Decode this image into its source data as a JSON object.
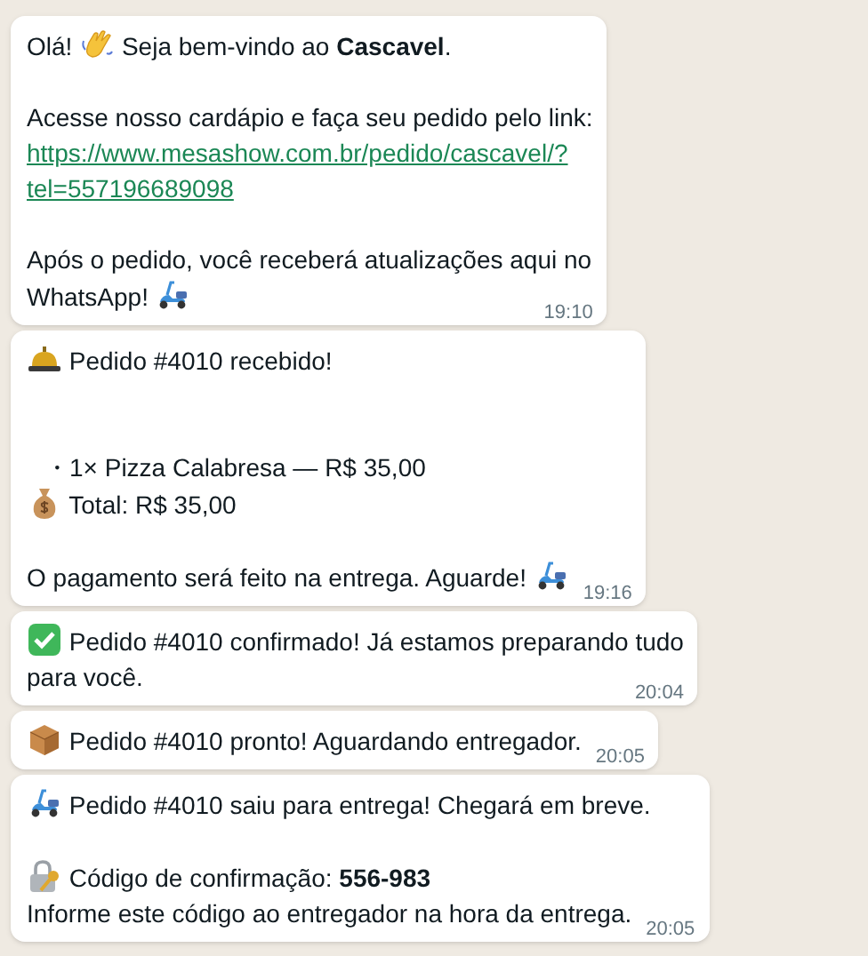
{
  "messages": [
    {
      "time": "19:10",
      "lines": [
        {
          "kind": "text",
          "text": "Olá! ",
          "icon_mid": true,
          "after": "Seja bem-vindo ao **Cascavel**."
        },
        {
          "kind": "blank"
        },
        {
          "kind": "text",
          "text": "Acesse nosso cardápio e faça seu pedido pelo link:"
        },
        {
          "kind": "link",
          "text": "https://www.mesashow.com.br/pedido/cascavel/?"
        },
        {
          "kind": "link",
          "text": "tel=557196689098"
        },
        {
          "kind": "blank"
        },
        {
          "kind": "text",
          "text": "Após o pedido, você receberá atualizações aqui no"
        },
        {
          "kind": "text",
          "text": "WhatsApp! ",
          "icon_end": true
        }
      ]
    },
    {
      "time": "19:16",
      "lines": [
        {
          "kind": "text",
          "icon_mid": true,
          "after": "Pedido #4010 recebido!"
        },
        {
          "kind": "blank"
        },
        {
          "kind": "blank"
        },
        {
          "kind": "bullet",
          "text": "・1× Pizza Calabresa — R$ 35,00"
        },
        {
          "kind": "text",
          "icon_mid": true,
          "after": "Total: R$ 35,00"
        },
        {
          "kind": "blank"
        },
        {
          "kind": "text",
          "text": "O pagamento será feito na entrega. Aguarde! ",
          "icon_end": true
        }
      ]
    },
    {
      "time": "20:04",
      "lines": [
        {
          "kind": "text",
          "icon_mid": true,
          "after": "Pedido #4010 confirmado! Já estamos preparando tudo"
        },
        {
          "kind": "text",
          "text": "para você."
        }
      ]
    },
    {
      "time": "20:05",
      "lines": [
        {
          "kind": "text",
          "icon_mid": true,
          "after": "Pedido #4010 pronto! Aguardando entregador."
        }
      ]
    },
    {
      "time": "20:05",
      "lines": [
        {
          "kind": "text",
          "icon_mid": true,
          "after": "Pedido #4010 saiu para entrega! Chegará em breve."
        },
        {
          "kind": "blank"
        },
        {
          "kind": "text",
          "icon_mid": true,
          "after": "Código de confirmação: **556-983**"
        },
        {
          "kind": "text",
          "text": "Informe este código ao entregador na hora da entrega."
        }
      ]
    }
  ]
}
